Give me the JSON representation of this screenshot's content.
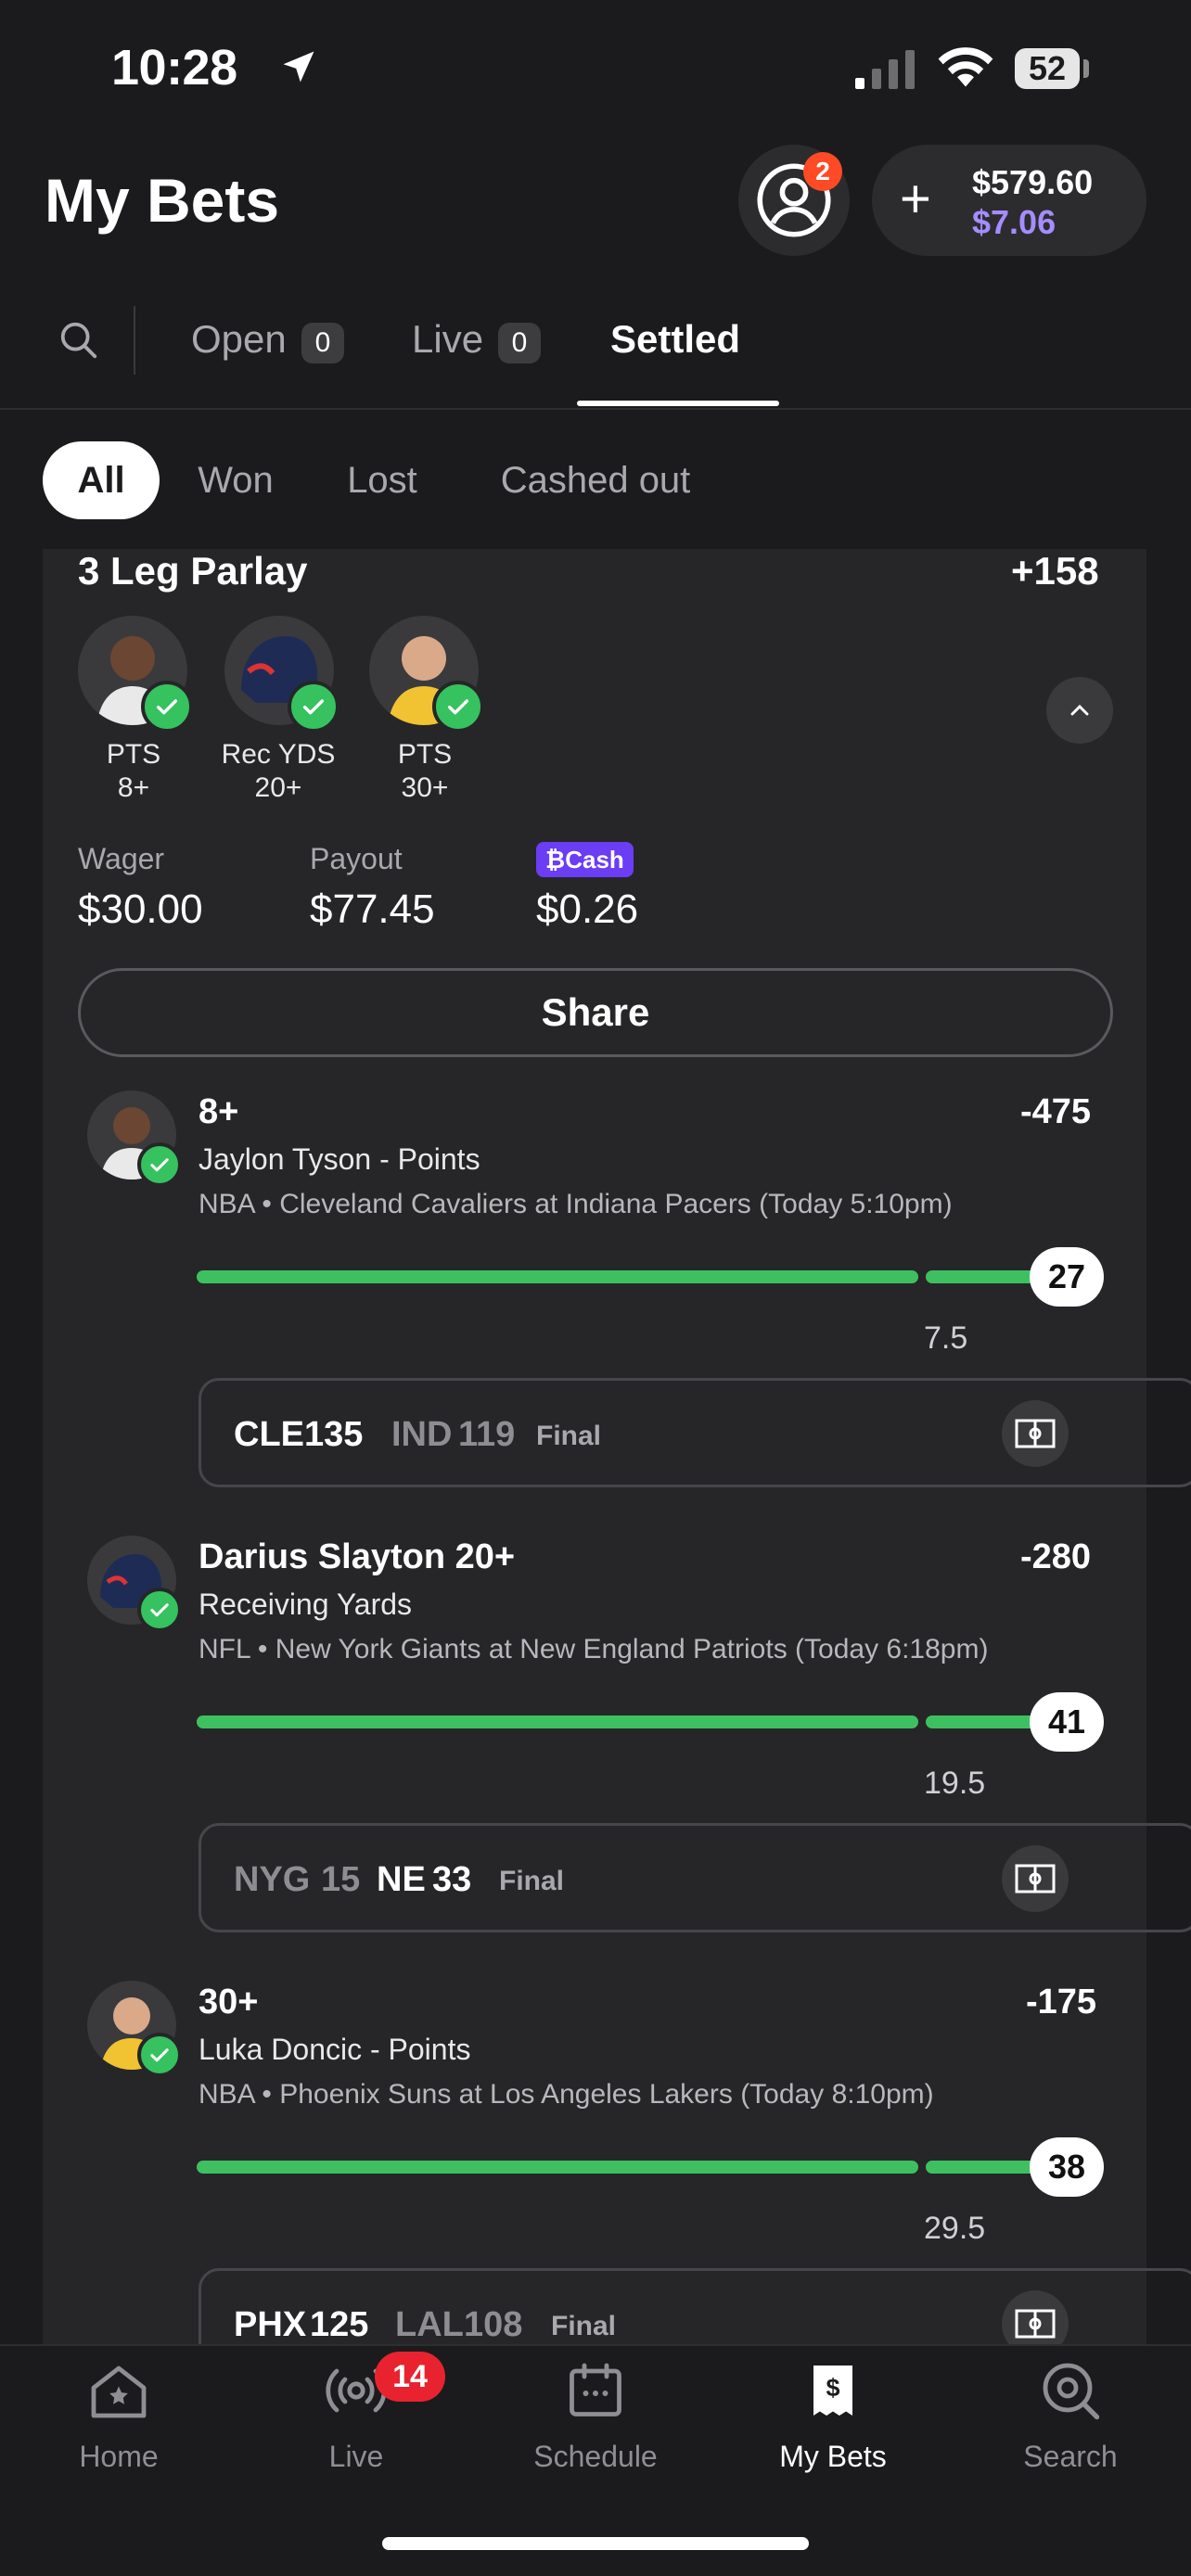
{
  "status_bar": {
    "time": "10:28",
    "battery": "52"
  },
  "header": {
    "title": "My Bets",
    "notifications_count": "2",
    "balance": "$579.60",
    "bonus_balance": "$7.06"
  },
  "tabs": {
    "open_label": "Open",
    "open_count": "0",
    "live_label": "Live",
    "live_count": "0",
    "settled_label": "Settled"
  },
  "filters": {
    "all": "All",
    "won": "Won",
    "lost": "Lost",
    "cashed_out": "Cashed out"
  },
  "parlay": {
    "title": "3 Leg Parlay",
    "odds": "+158",
    "legs": [
      {
        "stat": "PTS",
        "line": "8+"
      },
      {
        "stat": "Rec YDS",
        "line": "20+"
      },
      {
        "stat": "PTS",
        "line": "30+"
      }
    ],
    "wager_label": "Wager",
    "wager": "$30.00",
    "payout_label": "Payout",
    "payout": "$77.45",
    "cash_label": "Cash",
    "cash": "$0.26",
    "share_label": "Share"
  },
  "picks": [
    {
      "title": "8+",
      "odds": "-475",
      "subtitle": "Jaylon Tyson - Points",
      "game": "NBA • Cleveland Cavaliers at Indiana Pacers (Today 5:10pm)",
      "result": "27",
      "line": "7.5",
      "away": "CLE",
      "away_score": "135",
      "home": "IND",
      "home_score": "119",
      "status": "Final"
    },
    {
      "title": "Darius Slayton 20+",
      "odds": "-280",
      "subtitle": "Receiving Yards",
      "game": "NFL • New York Giants at New England Patriots (Today 6:18pm)",
      "result": "41",
      "line": "19.5",
      "away": "NYG",
      "away_score": "15",
      "home": "NE",
      "home_score": "33",
      "status": "Final"
    },
    {
      "title": "30+",
      "odds": "-175",
      "subtitle": "Luka Doncic - Points",
      "game": "NBA • Phoenix Suns at Los Angeles Lakers (Today 8:10pm)",
      "result": "38",
      "line": "29.5",
      "away": "PHX",
      "away_score": "125",
      "home": "LAL",
      "home_score": "108",
      "status": "Final"
    }
  ],
  "nav": {
    "home": "Home",
    "live": "Live",
    "live_badge": "14",
    "schedule": "Schedule",
    "my_bets": "My Bets",
    "search": "Search"
  },
  "colors": {
    "accent_green": "#3ec060",
    "bonus_purple": "#a58cff",
    "badge_red": "#e8232f"
  }
}
